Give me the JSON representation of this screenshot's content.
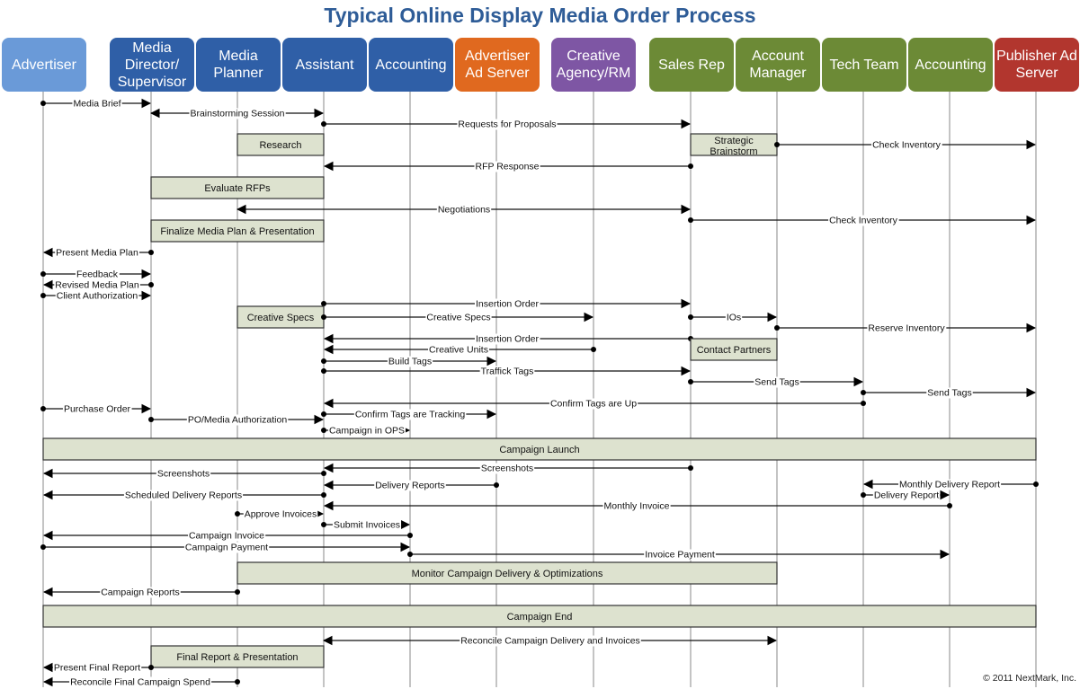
{
  "title": "Typical Online Display Media Order Process",
  "copyright": "© 2011 NextMark, Inc.",
  "colors": {
    "advertiser": "#6a9ad8",
    "agency": "#2f5fa7",
    "adserver": "#e0691f",
    "creative": "#7e56a4",
    "publisher": "#6c8a36",
    "publisher_ad_server": "#b2362e",
    "activity_fill": "#dde2cf",
    "title": "#2e5c97"
  },
  "lanes": [
    {
      "id": "advertiser",
      "label": "Advertiser",
      "group": "advertiser"
    },
    {
      "id": "media_director",
      "label": "Media Director/ Supervisor",
      "group": "agency"
    },
    {
      "id": "media_planner",
      "label": "Media Planner",
      "group": "agency"
    },
    {
      "id": "assistant",
      "label": "Assistant",
      "group": "agency"
    },
    {
      "id": "agency_accounting",
      "label": "Accounting",
      "group": "agency"
    },
    {
      "id": "advertiser_ad_server",
      "label": "Advertiser Ad Server",
      "group": "adserver"
    },
    {
      "id": "creative_agency",
      "label": "Creative Agency/RM",
      "group": "creative"
    },
    {
      "id": "sales_rep",
      "label": "Sales Rep",
      "group": "publisher"
    },
    {
      "id": "account_manager",
      "label": "Account Manager",
      "group": "publisher"
    },
    {
      "id": "tech_team",
      "label": "Tech Team",
      "group": "publisher"
    },
    {
      "id": "publisher_accounting",
      "label": "Accounting",
      "group": "publisher"
    },
    {
      "id": "publisher_ad_server",
      "label": "Publisher Ad Server",
      "group": "publisher_ad_server"
    }
  ],
  "steps": [
    {
      "type": "msg",
      "label": "Media Brief",
      "from": 0,
      "to": 1
    },
    {
      "type": "msg",
      "label": "Brainstorming Session",
      "from": 1,
      "to": 3,
      "both": true
    },
    {
      "type": "msg",
      "label": "Requests for Proposals",
      "from": 3,
      "to": 7
    },
    {
      "type": "box",
      "label": "Research",
      "from": 2,
      "to": 3
    },
    {
      "type": "box",
      "label": "Strategic Brainstorm",
      "from": 7,
      "to": 8
    },
    {
      "type": "msg",
      "label": "Check Inventory",
      "from": 8,
      "to": 11
    },
    {
      "type": "msg",
      "label": "RFP Response",
      "from": 7,
      "to": 3
    },
    {
      "type": "box",
      "label": "Evaluate RFPs",
      "from": 1,
      "to": 3
    },
    {
      "type": "msg",
      "label": "Negotiations",
      "from": 2,
      "to": 7,
      "both": true
    },
    {
      "type": "msg",
      "label": "Check Inventory",
      "from": 7,
      "to": 11
    },
    {
      "type": "box",
      "label": "Finalize Media Plan & Presentation",
      "from": 1,
      "to": 3
    },
    {
      "type": "msg",
      "label": "Present Media Plan",
      "from": 1,
      "to": 0
    },
    {
      "type": "msg",
      "label": "Feedback",
      "from": 0,
      "to": 1
    },
    {
      "type": "msg",
      "label": "Revised Media Plan",
      "from": 1,
      "to": 0
    },
    {
      "type": "msg",
      "label": "Client Authorization",
      "from": 0,
      "to": 1
    },
    {
      "type": "msg",
      "label": "Insertion Order",
      "from": 3,
      "to": 7
    },
    {
      "type": "box",
      "label": "Creative Specs",
      "from": 2,
      "to": 3
    },
    {
      "type": "msg",
      "label": "Creative Specs",
      "from": 3,
      "to": 6
    },
    {
      "type": "msg",
      "label": "IOs",
      "from": 7,
      "to": 8
    },
    {
      "type": "msg",
      "label": "Reserve Inventory",
      "from": 8,
      "to": 11
    },
    {
      "type": "msg",
      "label": "Insertion Order",
      "from": 7,
      "to": 3
    },
    {
      "type": "box",
      "label": "Contact Partners",
      "from": 7,
      "to": 8
    },
    {
      "type": "msg",
      "label": "Creative Units",
      "from": 6,
      "to": 3
    },
    {
      "type": "msg",
      "label": "Build Tags",
      "from": 3,
      "to": 5
    },
    {
      "type": "msg",
      "label": "Traffick Tags",
      "from": 3,
      "to": 7
    },
    {
      "type": "msg",
      "label": "Send Tags",
      "from": 7,
      "to": 9
    },
    {
      "type": "msg",
      "label": "Send Tags",
      "from": 9,
      "to": 11
    },
    {
      "type": "msg",
      "label": "Confirm Tags are Up",
      "from": 9,
      "to": 3
    },
    {
      "type": "msg",
      "label": "Purchase Order",
      "from": 0,
      "to": 1
    },
    {
      "type": "msg",
      "label": "PO/Media Authorization",
      "from": 1,
      "to": 3
    },
    {
      "type": "msg",
      "label": "Confirm Tags are Tracking",
      "from": 3,
      "to": 5
    },
    {
      "type": "msg",
      "label": "Campaign in OPS",
      "from": 3,
      "to": 4
    },
    {
      "type": "phase",
      "label": "Campaign Launch",
      "from": 0,
      "to": 11
    },
    {
      "type": "msg",
      "label": "Screenshots",
      "from": 7,
      "to": 3
    },
    {
      "type": "msg",
      "label": "Screenshots",
      "from": 3,
      "to": 0
    },
    {
      "type": "msg",
      "label": "Delivery Reports",
      "from": 5,
      "to": 3
    },
    {
      "type": "msg",
      "label": "Monthly Delivery Report",
      "from": 11,
      "to": 9
    },
    {
      "type": "msg",
      "label": "Scheduled Delivery Reports",
      "from": 3,
      "to": 0
    },
    {
      "type": "msg",
      "label": "Delivery Report",
      "from": 9,
      "to": 10
    },
    {
      "type": "msg",
      "label": "Monthly Invoice",
      "from": 10,
      "to": 3
    },
    {
      "type": "msg",
      "label": "Approve Invoices",
      "from": 2,
      "to": 3
    },
    {
      "type": "msg",
      "label": "Submit Invoices",
      "from": 3,
      "to": 4
    },
    {
      "type": "msg",
      "label": "Campaign Invoice",
      "from": 4,
      "to": 0
    },
    {
      "type": "msg",
      "label": "Campaign Payment",
      "from": 0,
      "to": 4
    },
    {
      "type": "msg",
      "label": "Invoice Payment",
      "from": 4,
      "to": 10
    },
    {
      "type": "box",
      "label": "Monitor Campaign Delivery & Optimizations",
      "from": 2,
      "to": 8
    },
    {
      "type": "msg",
      "label": "Campaign Reports",
      "from": 2,
      "to": 0
    },
    {
      "type": "phase",
      "label": "Campaign End",
      "from": 0,
      "to": 11
    },
    {
      "type": "msg",
      "label": "Reconcile Campaign Delivery and Invoices",
      "from": 3,
      "to": 8,
      "both": true
    },
    {
      "type": "box",
      "label": "Final Report & Presentation",
      "from": 1,
      "to": 3
    },
    {
      "type": "msg",
      "label": "Present Final Report",
      "from": 1,
      "to": 0
    },
    {
      "type": "msg",
      "label": "Reconcile Final Campaign Spend",
      "from": 2,
      "to": 0
    }
  ]
}
